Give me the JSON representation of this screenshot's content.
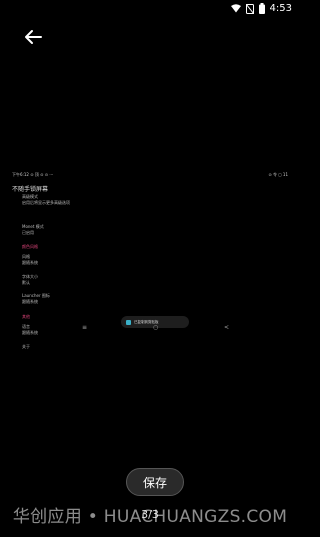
{
  "status_bar": {
    "time": "4:53",
    "icons": [
      "wifi-icon",
      "no-sim-icon",
      "battery-icon"
    ]
  },
  "toolbar": {
    "back_icon": "arrow-left-icon"
  },
  "screenshot_preview": {
    "status_left": "下午6:12 ⊙ 顶 ⊙ ⊙ ···",
    "status_right": "⊙ 令 ◻ 11",
    "title": "不随手锁屏幕",
    "sections": [
      {
        "label": "高级模式",
        "detail": "启用后将显示更多高级选项"
      },
      {
        "label": "Monet 模式",
        "detail": "已启用"
      },
      {
        "label": "颜色风格",
        "detail": "",
        "accent": true
      },
      {
        "label": "风格",
        "detail": "跟随系统"
      },
      {
        "label": "字体大小",
        "detail": "默认"
      },
      {
        "label": "Launcher 图标",
        "detail": "跟随系统"
      },
      {
        "label": "其他",
        "detail": "",
        "accent": true
      },
      {
        "label": "语言",
        "detail": "跟随系统"
      },
      {
        "label": "关于",
        "detail": ""
      }
    ],
    "toast": "已复制到剪贴板",
    "nav": [
      "≡",
      "○",
      "<"
    ]
  },
  "actions": {
    "save_label": "保存"
  },
  "pager": {
    "text": "3/3"
  },
  "watermark": "华创应用 • HUACHUANGZS.COM",
  "colors": {
    "accent": "#e0457b",
    "background": "#000000"
  }
}
